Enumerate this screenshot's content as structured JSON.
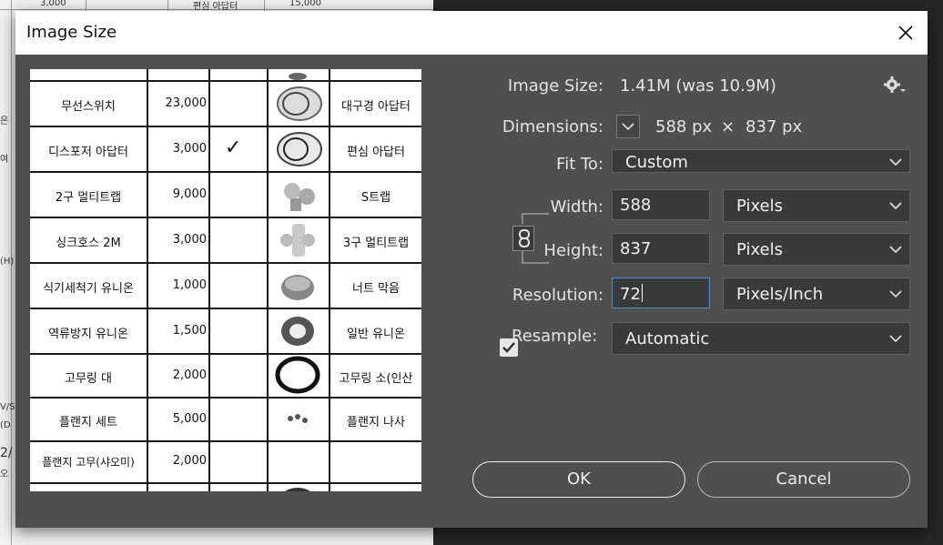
{
  "background_document": {
    "visible_text": [
      "3,000",
      "편심 아답터",
      "15,000",
      "은",
      "여",
      "(H)",
      "V/S",
      "(D",
      "2/",
      "오"
    ]
  },
  "dialog": {
    "title": "Image Size",
    "close_icon": "close-icon",
    "image_size": {
      "label": "Image Size:",
      "value": "1.41M (was 10.9M)"
    },
    "settings_icon": "gear-icon",
    "dimensions": {
      "label": "Dimensions:",
      "width": "588 px",
      "times": "×",
      "height": "837 px"
    },
    "fit_to": {
      "label": "Fit To:",
      "value": "Custom"
    },
    "width": {
      "label": "Width:",
      "value": "588",
      "unit": "Pixels"
    },
    "height": {
      "label": "Height:",
      "value": "837",
      "unit": "Pixels"
    },
    "link_icon": "chain-link-icon",
    "resolution": {
      "label": "Resolution:",
      "value": "72",
      "unit": "Pixels/Inch"
    },
    "resample": {
      "label": "Resample:",
      "checked": true,
      "value": "Automatic"
    },
    "ok_label": "OK",
    "cancel_label": "Cancel"
  },
  "preview": {
    "rows": [
      {
        "name": "무선스위치",
        "price": "23,000",
        "mark": "",
        "desc": "대구경 아답터"
      },
      {
        "name": "디스포저 아답터",
        "price": "3,000",
        "mark": "✓",
        "desc": "편심 아답터"
      },
      {
        "name": "2구 멀티트랩",
        "price": "9,000",
        "mark": "",
        "desc": "S트랩"
      },
      {
        "name": "싱크호스 2M",
        "price": "3,000",
        "mark": "",
        "desc": "3구 멀티트랩"
      },
      {
        "name": "식기세척기 유니온",
        "price": "1,000",
        "mark": "",
        "desc": "너트 막음"
      },
      {
        "name": "역류방지 유니온",
        "price": "1,500",
        "mark": "",
        "desc": "일반 유니온"
      },
      {
        "name": "고무링 대",
        "price": "2,000",
        "mark": "",
        "desc": "고무링 소(인산"
      },
      {
        "name": "플랜지 세트",
        "price": "5,000",
        "mark": "",
        "desc": "플랜지 나사"
      },
      {
        "name": "플랜지 고무(샤오미)",
        "price": "2,000",
        "mark": "",
        "desc": ""
      }
    ]
  },
  "colors": {
    "dialog_bg": "#4f4f4f",
    "field_bg": "#3a3a3a",
    "focus_border": "#4a90e2"
  }
}
